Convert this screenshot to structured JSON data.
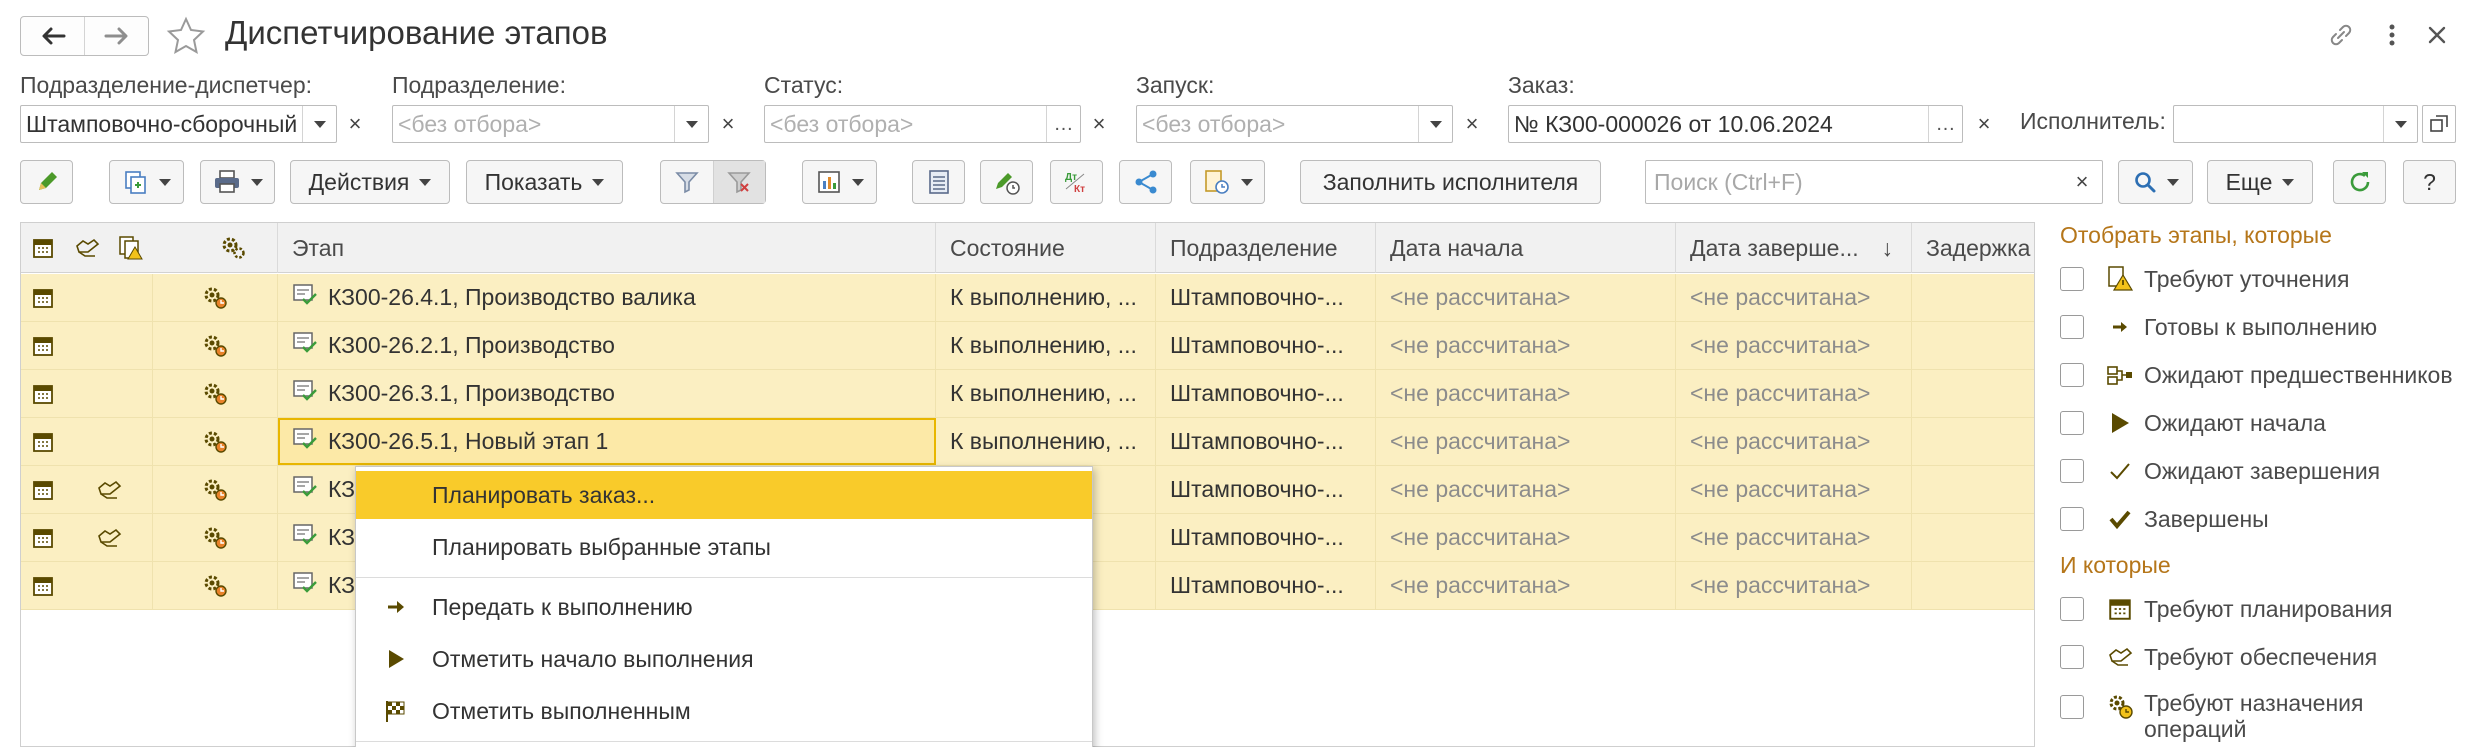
{
  "window": {
    "title": "Диспетчирование этапов"
  },
  "filters": {
    "dispatcher_label": "Подразделение-диспетчер:",
    "dispatcher_value": "Штамповочно-сборочный",
    "department_label": "Подразделение:",
    "department_placeholder": "<без отбора>",
    "status_label": "Статус:",
    "status_placeholder": "<без отбора>",
    "launch_label": "Запуск:",
    "launch_placeholder": "<без отбора>",
    "order_label": "Заказ:",
    "order_value": "№ КЗ00-000026 от 10.06.2024",
    "performer_label": "Исполнитель:",
    "performer_value": ""
  },
  "toolbar": {
    "actions_label": "Действия",
    "show_label": "Показать",
    "fill_performer_label": "Заполнить исполнителя",
    "search_placeholder": "Поиск (Ctrl+F)",
    "more_label": "Еще",
    "help_label": "?",
    "clear_glyph": "×"
  },
  "table": {
    "columns": [
      "Этап",
      "Состояние",
      "Подразделение",
      "Дата начала",
      "Дата заверше...",
      "Задержка"
    ],
    "sort_indicator": "↓",
    "rows": [
      {
        "stage": "КЗ00-26.4.1, Производство валика",
        "state": "К выполнению, ...",
        "dept": "Штамповочно-...",
        "start": "<не рассчитана>",
        "end": "<не рассчитана>",
        "delay": "",
        "provision": false
      },
      {
        "stage": "КЗ00-26.2.1, Производство",
        "state": "К выполнению, ...",
        "dept": "Штамповочно-...",
        "start": "<не рассчитана>",
        "end": "<не рассчитана>",
        "delay": "",
        "provision": false
      },
      {
        "stage": "КЗ00-26.3.1, Производство",
        "state": "К выполнению, ...",
        "dept": "Штамповочно-...",
        "start": "<не рассчитана>",
        "end": "<не рассчитана>",
        "delay": "",
        "provision": false
      },
      {
        "stage": "КЗ00-26.5.1, Новый этап 1",
        "state": "К выполнению, ...",
        "dept": "Штамповочно-...",
        "start": "<не рассчитана>",
        "end": "<не рассчитана>",
        "delay": "",
        "provision": false
      },
      {
        "stage": "КЗ",
        "state": "",
        "dept": "Штамповочно-...",
        "start": "<не рассчитана>",
        "end": "<не рассчитана>",
        "delay": "",
        "provision": true
      },
      {
        "stage": "КЗ",
        "state": "",
        "dept": "Штамповочно-...",
        "start": "<не рассчитана>",
        "end": "<не рассчитана>",
        "delay": "",
        "provision": true
      },
      {
        "stage": "КЗ",
        "state": "",
        "dept": "Штамповочно-...",
        "start": "<не рассчитана>",
        "end": "<не рассчитана>",
        "delay": "",
        "provision": false
      }
    ]
  },
  "context_menu": {
    "items": [
      {
        "label": "Планировать заказ...",
        "icon": "none"
      },
      {
        "label": "Планировать выбранные этапы",
        "icon": "none"
      },
      {
        "label": "Передать к выполнению",
        "icon": "arrow-right-icon"
      },
      {
        "label": "Отметить начало выполнения",
        "icon": "play-icon"
      },
      {
        "label": "Отметить выполненным",
        "icon": "checkered-flag-icon"
      }
    ]
  },
  "right_panel": {
    "header1": "Отобрать этапы, которые",
    "items1": [
      "Требуют уточнения",
      "Готовы к выполнению",
      "Ожидают предшественников",
      "Ожидают начала",
      "Ожидают завершения",
      "Завершены"
    ],
    "header2": "И которые",
    "items2": [
      "Требуют планирования",
      "Требуют обеспечения",
      "Требуют назначения",
      "операций"
    ]
  },
  "colors": {
    "row_highlight": "#fbefc2",
    "menu_active": "#f9cb2a",
    "panel_header": "#b5761a",
    "refresh_green": "#3a9b3a",
    "accent_dark": "#5a4a00"
  }
}
